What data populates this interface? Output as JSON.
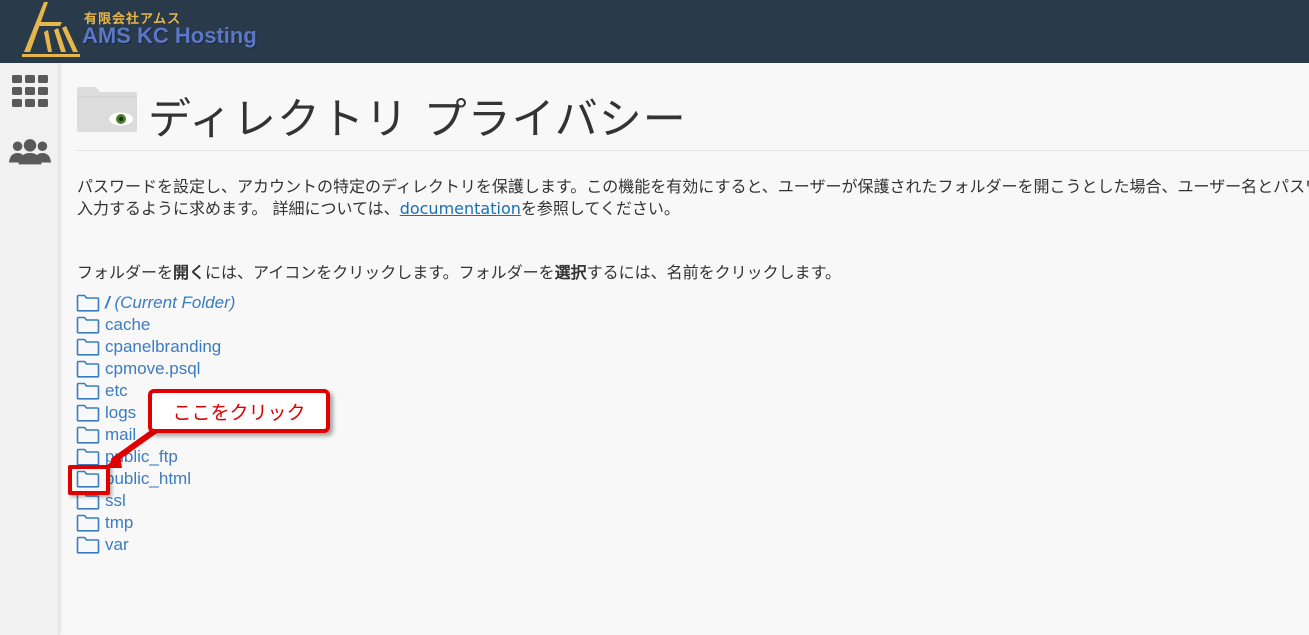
{
  "header": {
    "logo_jp": "有限会社アムス",
    "logo_en": "AMS KC Hosting"
  },
  "sidebar": {
    "items": [
      {
        "icon": "apps-grid-icon"
      },
      {
        "icon": "users-group-icon"
      }
    ]
  },
  "page": {
    "title": "ディレクトリ プライバシー",
    "desc_line1": "パスワードを設定し、アカウントの特定のディレクトリを保護します。この機能を有効にすると、ユーザーが保護されたフォルダーを開こうとした場合、ユーザー名とパスワードを",
    "desc_line2_pre": "入力するように求めます。 詳細については、",
    "desc_link": "documentation",
    "desc_line2_post": "を参照してください。",
    "instr_1": "フォルダーを",
    "instr_2": "開く",
    "instr_3": "には、アイコンをクリックします。フォルダーを",
    "instr_4": "選択",
    "instr_5": "するには、名前をクリックします。"
  },
  "folders": {
    "current_slash": "/",
    "current_label": "(Current Folder)",
    "items": [
      "cache",
      "cpanelbranding",
      "cpmove.psql",
      "etc",
      "logs",
      "mail",
      "public_ftp",
      "public_html",
      "ssl",
      "tmp",
      "var"
    ]
  },
  "annotation": {
    "callout": "ここをクリック",
    "color": "#e00000"
  },
  "colors": {
    "header_bg": "#293a4a",
    "link": "#3a7cc1"
  }
}
